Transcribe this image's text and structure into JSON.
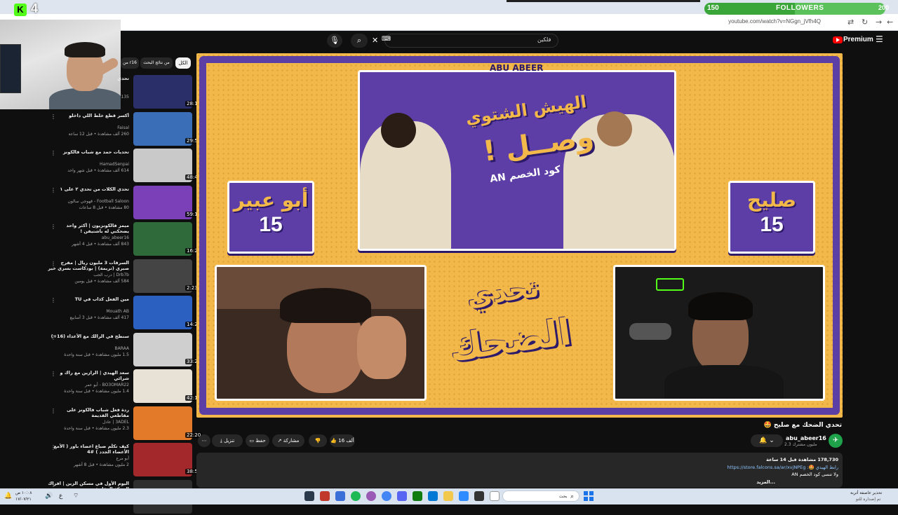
{
  "browser": {
    "url": "youtube.com/watch?v=NGgn_jVfh4Q",
    "followers_current": "150",
    "followers_label": "FOLLOWERS",
    "followers_goal": "200",
    "followers_progress": 0.5,
    "kick_count": "4"
  },
  "header": {
    "search_value": "فلكين",
    "premium_label": "Premium"
  },
  "chips": {
    "all": "الكل",
    "related_search": "من نتائج البحث",
    "from": "من r16"
  },
  "sidebar": {
    "items": [
      {
        "title": "تحدي",
        "channel": "",
        "meta": "135",
        "duration": "28:18",
        "thumb": "#2a2f6a"
      },
      {
        "title": "أكسر قطع خلط اللي داخلو",
        "channel": "Faisal",
        "meta": "260 ألف مشاهدة • قبل 12 ساعة",
        "duration": "29:59",
        "thumb": "#3a6fb8"
      },
      {
        "title": "تحديات حمد مع شباب فالكونز",
        "channel": "HamadSenpai",
        "meta": "614 ألف مشاهدة • قبل شهر واحد",
        "duration": "48:45",
        "thumb": "#c9c9c9"
      },
      {
        "title": "تحدي الكلات من تحدي ٢ على ١",
        "channel": "Football Saloon - قهوجي سالون",
        "meta": "80 مشاهدة • قبل 8 ساعات",
        "duration": "59:12",
        "thumb": "#7b3fb8"
      },
      {
        "title": "ميمز فالكونزيون | أكثر واحد يضحكني له باشتيفن !",
        "channel": "abu_abeer16",
        "meta": "843 ألف مشاهدة • قبل 4 أشهر",
        "duration": "16:27",
        "thumb": "#2f6a3a"
      },
      {
        "title": "السرقات 3 مليون ريال | مقرح صبري (تريمة) | بودكاست بسري خير",
        "channel": "Drb7b | درب الحب",
        "meta": "584 ألف مشاهدة • قبل يومين",
        "duration": "2:23:20",
        "thumb": "#444"
      },
      {
        "title": "مين الفعل كذاب في TU",
        "channel": "Mouath AB",
        "meta": "417 ألف مشاهدة • قبل 3 أسابيع",
        "duration": "14:26",
        "thumb": "#2b5fc0"
      },
      {
        "title": "سنطح في الرالك مع الأعداء (16+)",
        "channel": "BARAA",
        "meta": "1.5 مليون مشاهدة • قبل سنة واحدة",
        "duration": "33:24",
        "thumb": "#cfcfcf"
      },
      {
        "title": "سعد الهيدي | الرازين مع راك و شرائي",
        "channel": "BO3OMAR22 - أبو عمر",
        "meta": "1.4 مليون مشاهدة • قبل سنة واحدة",
        "duration": "42:11",
        "thumb": "#e8e2d6"
      },
      {
        "title": "ردة فعل شباب فالكونز على مقاطعي القديمة",
        "channel": "3ADEL | عادل",
        "meta": "2.3 مليون مشاهدة • قبل سنة واحدة",
        "duration": "22:20",
        "thumb": "#e37a2a"
      },
      {
        "title": "كيف تكلّم ضباع اعضاء باور ( الأمع الأعضاء الجدد ) #4",
        "channel": "أبو مرع",
        "meta": "2 مليون مشاهدة • قبل 8 أشهر",
        "duration": "38:59",
        "thumb": "#a2282b"
      },
      {
        "title": "اليوم الأول في مسكن الزين | افراك الحركة الرقابية",
        "channel": "",
        "meta": "",
        "duration": "",
        "thumb": "#2e2e2e"
      }
    ]
  },
  "player": {
    "banner_logo": "ABU ABEER",
    "banner_title1": "الهيش الشتوي",
    "banner_title2": "وصــل !",
    "banner_sub": "كود الخصم AN",
    "left_name": "أبو عبير",
    "left_score": "15",
    "right_name": "صليح",
    "right_score": "15",
    "challenge_line1": "تحدي",
    "challenge_line2": "الضحك"
  },
  "video": {
    "title": "تحدي الضحك مع صليح 🤩",
    "channel": "abu_abeer16",
    "subscribers": "2.3 مليون مشترك",
    "likes": "16 ألف",
    "share": "مشاركة",
    "save": "حفظ",
    "download": "تنزيل",
    "views": "178,730 مشاهدة قبل 14 ساعة",
    "desc_line1": "رابط الهيدي 🤩: https://store.falcons.sa/ar/xvjNPEg",
    "desc_line2": "ولا تنسى كود الخصم AN",
    "more": "...المزيد"
  },
  "taskbar": {
    "search_label": "بحث",
    "weather": "تحذير عاصفة أتربة",
    "weather_sub": "تم إصدارة للتو",
    "time": "١٠:٠٨ ص",
    "date": "١٧/٠٧/٢١"
  }
}
